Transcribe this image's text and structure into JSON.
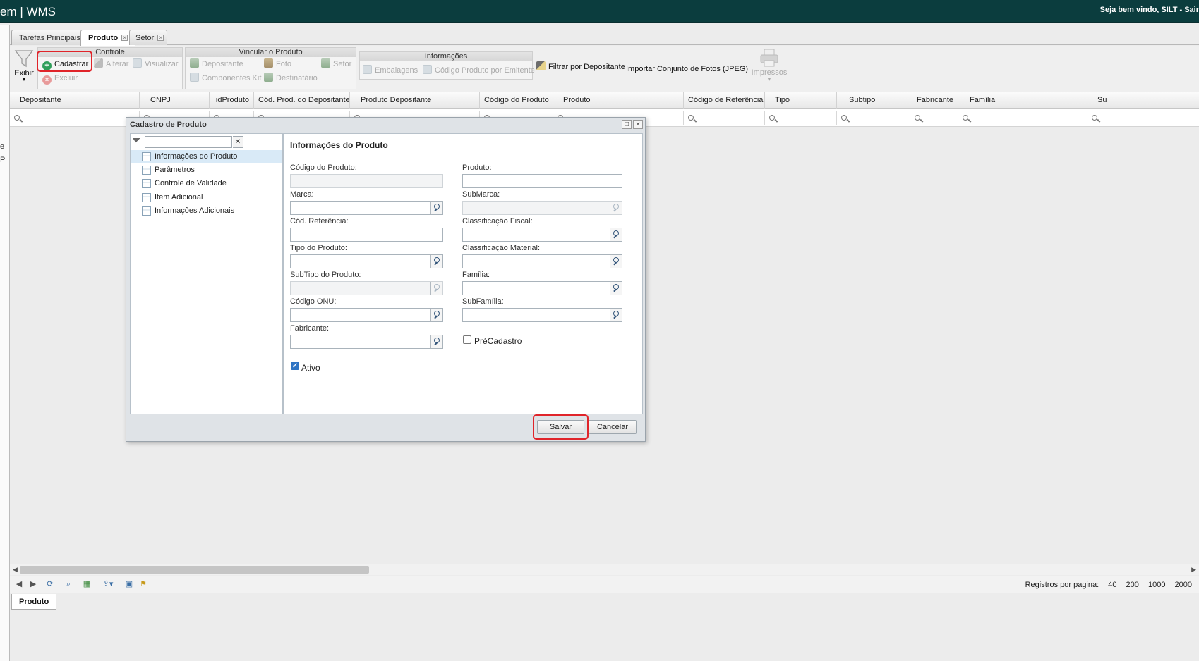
{
  "header": {
    "title": "em | WMS",
    "welcome": "Seja bem vindo, SILT - Sair"
  },
  "left_strip": [
    "e",
    "P"
  ],
  "tabs": [
    {
      "label": "Tarefas Principais"
    },
    {
      "label": "Produto"
    },
    {
      "label": "Setor"
    }
  ],
  "ribbon": {
    "exibir": "Exibir",
    "controle": {
      "title": "Controle",
      "cadastrar": "Cadastrar",
      "alterar": "Alterar",
      "visualizar": "Visualizar",
      "excluir": "Excluir"
    },
    "vincular": {
      "title": "Vincular o Produto",
      "depositante": "Depositante",
      "foto": "Foto",
      "setor": "Setor",
      "componentes_kit": "Componentes Kit",
      "destinatario": "Destinatário"
    },
    "informacoes": {
      "title": "Informações",
      "embalagens": "Embalagens",
      "codigo_emitente": "Código Produto por Emitente"
    },
    "filtrar": "Filtrar por Depositante",
    "importar": "Importar Conjunto de Fotos (JPEG)",
    "impressos": "Impressos"
  },
  "grid": {
    "columns": [
      "Depositante",
      "CNPJ",
      "idProduto",
      "Cód. Prod. do Depositante",
      "Produto Depositante",
      "Código do Produto",
      "Produto",
      "Código de Referência",
      "Tipo",
      "Subtipo",
      "Fabricante",
      "Família",
      "Su"
    ]
  },
  "pager": {
    "label": "Registros por pagina:",
    "sizes": [
      "40",
      "200",
      "1000",
      "2000"
    ]
  },
  "bottom_tab": "Produto",
  "modal": {
    "title": "Cadastro de Produto",
    "nav_items": [
      "Informações do Produto",
      "Parâmetros",
      "Controle de Validade",
      "Item Adicional",
      "Informações Adicionais"
    ],
    "form_title": "Informações do Produto",
    "labels": {
      "codigo_produto": "Código do Produto:",
      "produto": "Produto:",
      "marca": "Marca:",
      "submarca": "SubMarca:",
      "cod_referencia": "Cód. Referência:",
      "class_fiscal": "Classificação Fiscal:",
      "tipo_produto": "Tipo do Produto:",
      "class_material": "Classificação Material:",
      "subtipo_produto": "SubTipo do Produto:",
      "familia": "Família:",
      "codigo_onu": "Código ONU:",
      "subfamilia": "SubFamília:",
      "fabricante": "Fabricante:",
      "precadastro": "PréCadastro",
      "ativo": "Ativo"
    },
    "save": "Salvar",
    "cancel": "Cancelar"
  }
}
